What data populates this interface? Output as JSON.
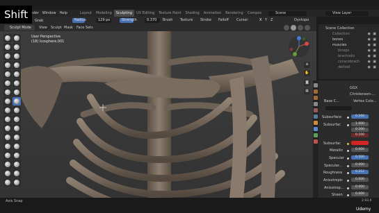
{
  "topbar": {
    "menus": [
      "Render",
      "Window",
      "Help"
    ],
    "workspace_tabs": [
      "Layout",
      "Modeling",
      "Sculpting",
      "UV Editing",
      "Texture Paint",
      "Shading",
      "Animation",
      "Rendering",
      "Compos"
    ],
    "active_tab": "Sculpting",
    "scene": "Scene",
    "view_layer": "View Layer"
  },
  "toolbar": {
    "brush": "Grab",
    "radius_label": "Radius",
    "radius_value": "129 px",
    "strength_label": "Strength",
    "strength_value": "0.370",
    "menus": [
      "Brush",
      "Texture",
      "Stroke",
      "Falloff",
      "Cursor"
    ],
    "symmetry": [
      "X",
      "Y",
      "Z"
    ],
    "overlay_label": "Dyntopo"
  },
  "viewport_header": {
    "mode": "Sculpt Mode",
    "menus": [
      "View",
      "Sculpt",
      "Mask",
      "Face Sets"
    ]
  },
  "viewport": {
    "view_name": "User Perspective",
    "object_info": "(18) Icosphere.001"
  },
  "outliner": {
    "rows": [
      {
        "label": "Scene Collection"
      },
      {
        "label": "Collection"
      },
      {
        "label": "bones"
      },
      {
        "label": "muscles"
      },
      {
        "label": "biceps"
      },
      {
        "label": "brachialis"
      },
      {
        "label": "coracobrach"
      },
      {
        "label": "deltoid"
      }
    ]
  },
  "properties": {
    "render_engine": "GGX",
    "subsurface_method": "Christensen-...",
    "base_color_label": "Base C...",
    "vertex_color": "Vertex Colo...",
    "rows": [
      {
        "label": "Subsurface",
        "value": "0.160"
      },
      {
        "label": "Subsurfac",
        "value": "1.000"
      },
      {
        "label": "",
        "value": "0.200"
      },
      {
        "label": "",
        "value": "0.100"
      },
      {
        "label": "Subsurfac",
        "value": ""
      },
      {
        "label": "Metallic",
        "value": "0.000"
      },
      {
        "label": "Specular",
        "value": "0.500"
      },
      {
        "label": "Specular...",
        "value": "0.000"
      },
      {
        "label": "Roughness",
        "value": "0.212"
      },
      {
        "label": "Anisotropic",
        "value": "0.000"
      },
      {
        "label": "Anisotrop...",
        "value": "0.000"
      },
      {
        "label": "Sheen",
        "value": "0.000"
      }
    ]
  },
  "status": {
    "left": "Axis Snap",
    "right": "2.93.0",
    "udemy": "Udemy"
  },
  "overlay": {
    "key": "Shift"
  },
  "colors": {
    "accent": "#4772b3",
    "subsurface_color": "#d42424",
    "bone": "#7d6f63"
  }
}
